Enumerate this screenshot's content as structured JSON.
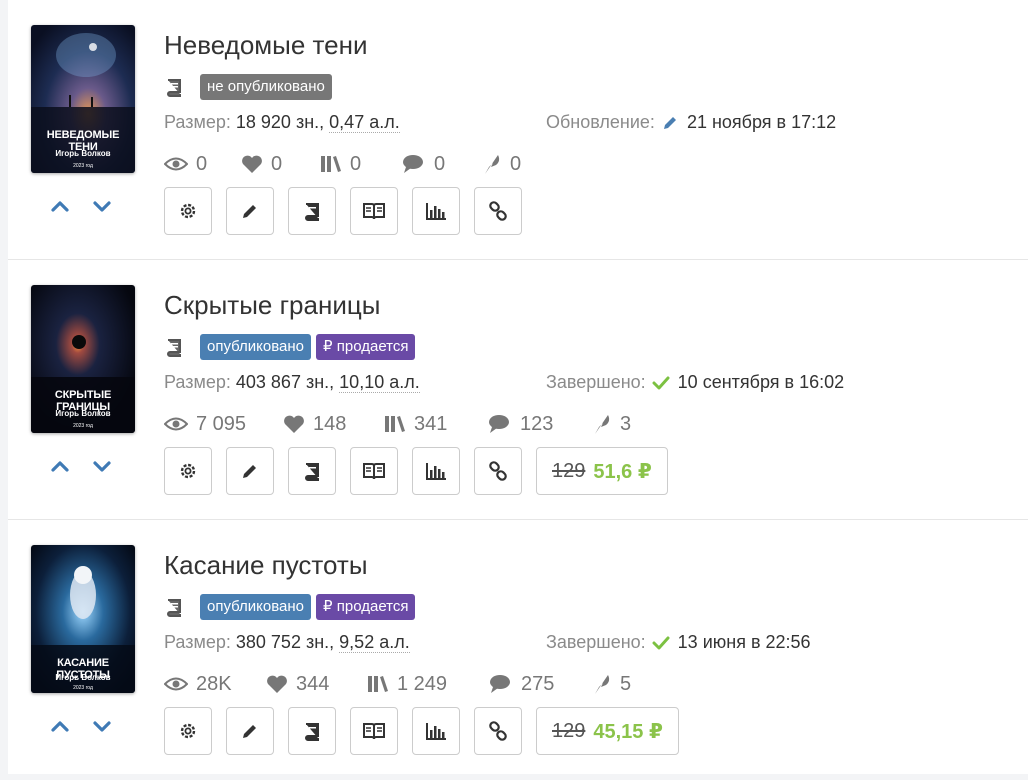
{
  "books": [
    {
      "title": "Неведомые тени",
      "cover": {
        "title": "НЕВЕДОМЫЕ ТЕНИ",
        "author": "Игорь Волков",
        "year": "2023 год"
      },
      "tags": [
        {
          "label": "не опубликовано",
          "color": "#777777"
        }
      ],
      "size_label": "Размер:",
      "size_chars": "18 920 зн.,",
      "size_al": "0,47 а.л.",
      "date_label": "Обновление:",
      "date_icon": "pencil-icon",
      "date_value": "21 ноября в 17:12",
      "stats": {
        "views": "0",
        "likes": "0",
        "libraries": "0",
        "comments": "0",
        "awards": "0"
      },
      "price": null
    },
    {
      "title": "Скрытые границы",
      "cover": {
        "title": "СКРЫТЫЕ ГРАНИЦЫ",
        "author": "Игорь Волков",
        "year": "2023 год"
      },
      "tags": [
        {
          "label": "опубликовано",
          "color": "#4a7fb2"
        },
        {
          "label": "₽ продается",
          "color": "#6a4aa6"
        }
      ],
      "size_label": "Размер:",
      "size_chars": "403 867 зн.,",
      "size_al": "10,10 а.л.",
      "date_label": "Завершено:",
      "date_icon": "check-icon",
      "date_value": "10 сентября в 16:02",
      "stats": {
        "views": "7 095",
        "likes": "148",
        "libraries": "341",
        "comments": "123",
        "awards": "3"
      },
      "price": {
        "old": "129",
        "new": "51,6 ₽"
      }
    },
    {
      "title": "Касание пустоты",
      "cover": {
        "title": "КАСАНИЕ ПУСТОТЫ",
        "author": "Игорь Волков",
        "year": "2023 год"
      },
      "tags": [
        {
          "label": "опубликовано",
          "color": "#4a7fb2"
        },
        {
          "label": "₽ продается",
          "color": "#6a4aa6"
        }
      ],
      "size_label": "Размер:",
      "size_chars": "380 752 зн.,",
      "size_al": "9,52 а.л.",
      "date_label": "Завершено:",
      "date_icon": "check-icon",
      "date_value": "13 июня в 22:56",
      "stats": {
        "views": "28K",
        "likes": "344",
        "libraries": "1 249",
        "comments": "275",
        "awards": "5"
      },
      "price": {
        "old": "129",
        "new": "45,15 ₽"
      }
    }
  ],
  "action_buttons": [
    "settings-icon",
    "edit-icon",
    "book-icon",
    "read-icon",
    "stats-icon",
    "link-icon"
  ],
  "colors": {
    "accent_blue": "#4a7fb2",
    "sale_purple": "#6a4aa6",
    "price_green": "#8bc34a",
    "check_green": "#7cc142",
    "arrow_blue": "#3f7ab5"
  }
}
